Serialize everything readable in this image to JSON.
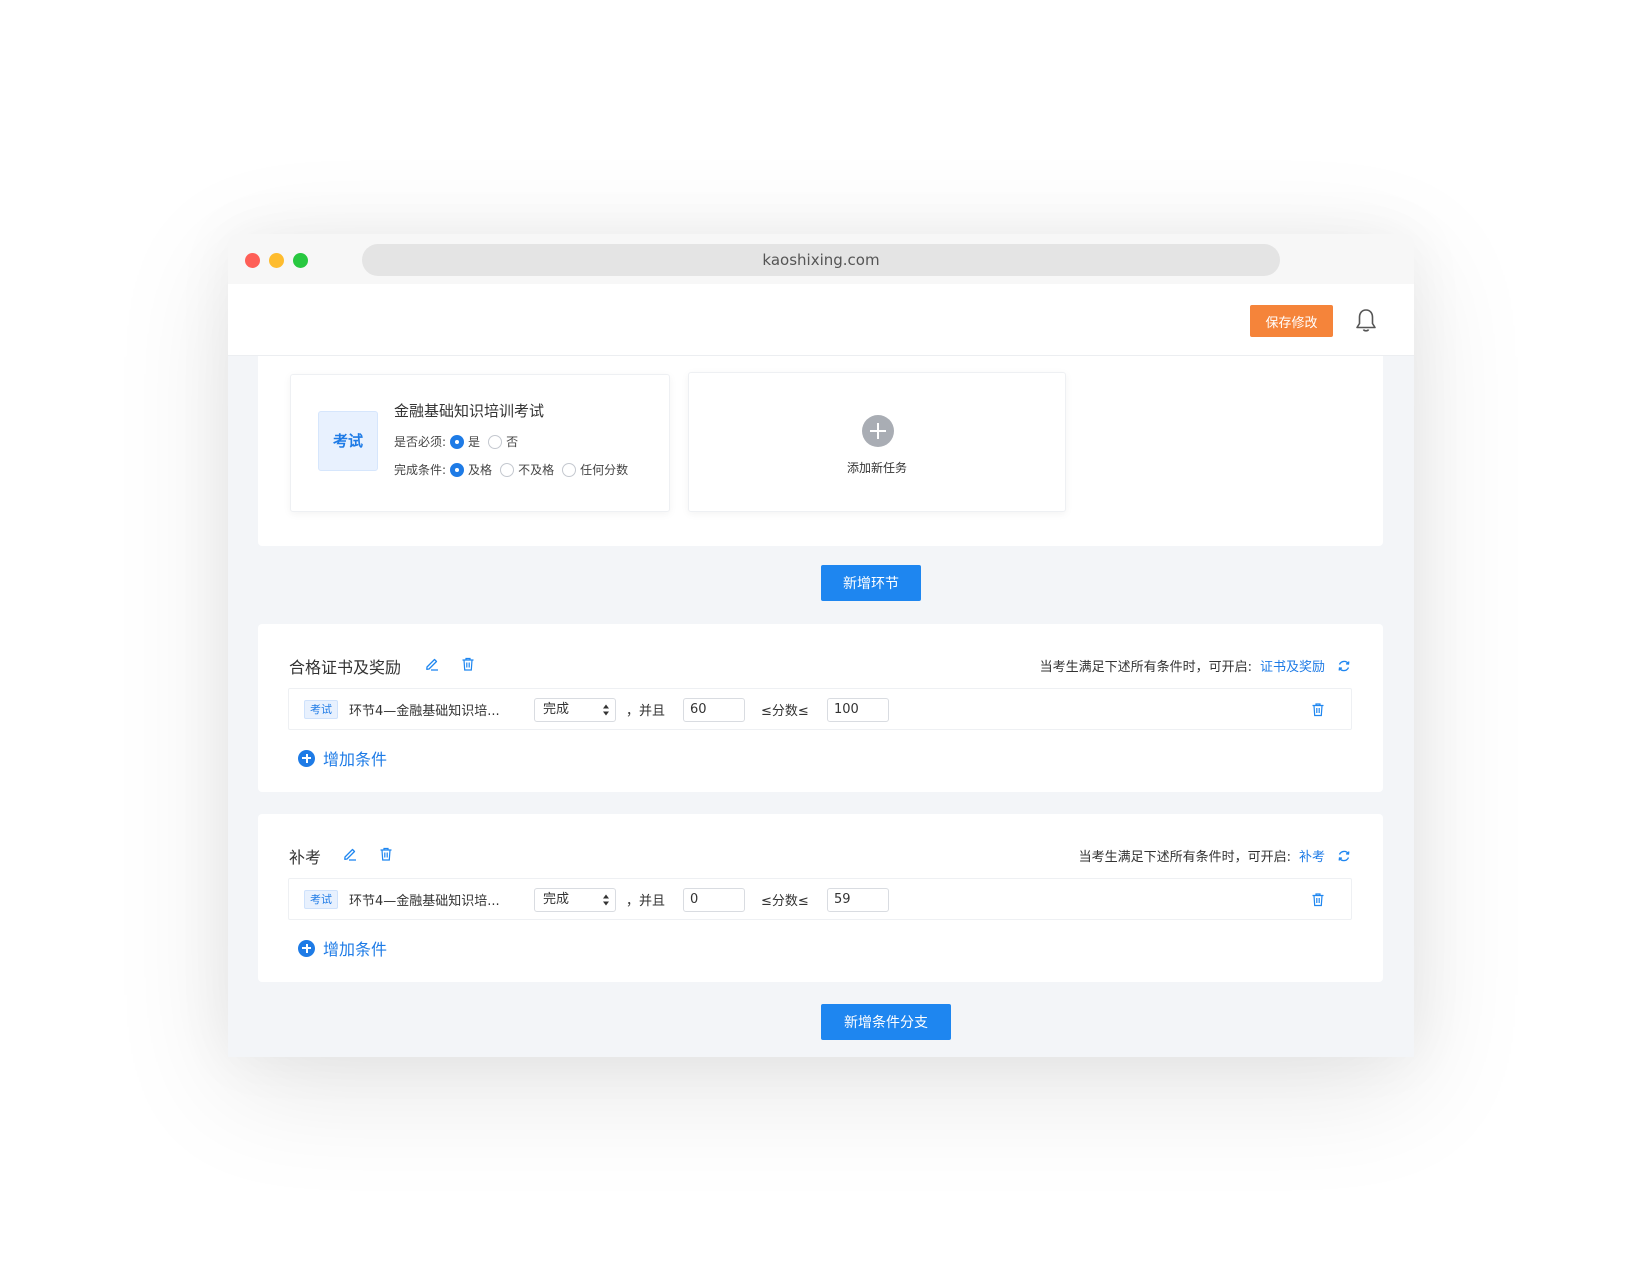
{
  "browser": {
    "url": "kaoshixing.com"
  },
  "header": {
    "save_label": "保存修改"
  },
  "stage": {
    "task": {
      "type_label": "考试",
      "title": "金融基础知识培训考试",
      "required_label": "是否必须:",
      "required_options": [
        "是",
        "否"
      ],
      "required_selected": "是",
      "complete_label": "完成条件:",
      "complete_options": [
        "及格",
        "不及格",
        "任何分数"
      ],
      "complete_selected": "及格"
    },
    "add_task_label": "添加新任务"
  },
  "add_stage_label": "新增环节",
  "branches": [
    {
      "title": "合格证书及奖励",
      "condition_hint": "当考生满足下述所有条件时，可开启:",
      "unlock_link": "证书及奖励",
      "condition": {
        "tag": "考试",
        "name": "环节4—金融基础知识培...",
        "status": "完成",
        "and_label": "，并且",
        "min_score": "60",
        "score_label": "≤分数≤",
        "max_score": "100"
      },
      "add_condition_label": "增加条件"
    },
    {
      "title": "补考",
      "condition_hint": "当考生满足下述所有条件时，可开启:",
      "unlock_link": "补考",
      "condition": {
        "tag": "考试",
        "name": "环节4—金融基础知识培...",
        "status": "完成",
        "and_label": "，并且",
        "min_score": "0",
        "score_label": "≤分数≤",
        "max_score": "59"
      },
      "add_condition_label": "增加条件"
    }
  ],
  "add_branch_label": "新增条件分支",
  "colors": {
    "accent": "#1e86f0",
    "save": "#f5843a",
    "link": "#1e7be6"
  }
}
